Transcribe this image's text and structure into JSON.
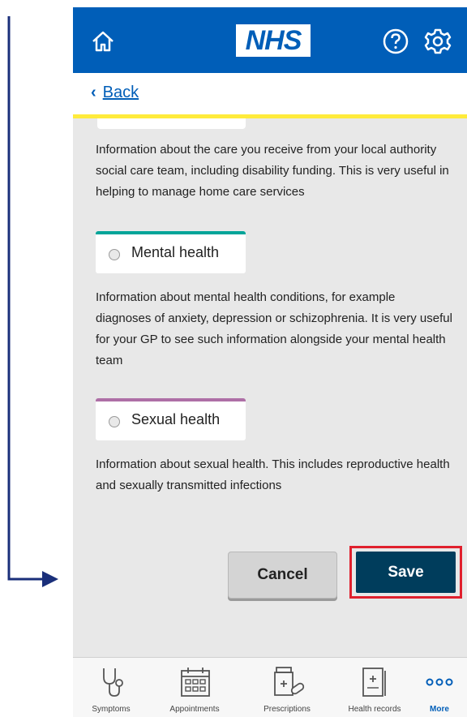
{
  "header": {
    "logo_text": "NHS",
    "home_icon": "home-icon",
    "help_icon": "help-icon",
    "settings_icon": "gear-icon",
    "brand_color": "#005eb8"
  },
  "back": {
    "label": "Back"
  },
  "sections": [
    {
      "description": "Information about the care you receive from your local authority social care team, including disability funding. This is very useful in helping to manage home care services"
    },
    {
      "label": "Mental health",
      "accent": "#00a499",
      "selected": false,
      "description": "Information about mental health conditions, for example diagnoses of anxiety, depression or schizophrenia. It is very useful for your GP to see such information alongside your mental health team"
    },
    {
      "label": "Sexual health",
      "accent": "#ae6fa6",
      "selected": false,
      "description": "Information about sexual health. This includes reproductive health and sexually transmitted infections"
    }
  ],
  "actions": {
    "cancel_label": "Cancel",
    "save_label": "Save",
    "highlight_color": "#e0202d"
  },
  "tabs": [
    {
      "label": "Symptoms",
      "icon": "stethoscope-icon"
    },
    {
      "label": "Appointments",
      "icon": "calendar-icon"
    },
    {
      "label": "Prescriptions",
      "icon": "pills-icon"
    },
    {
      "label": "Health records",
      "icon": "records-icon"
    },
    {
      "label": "More",
      "icon": "more-icon",
      "active": true
    }
  ]
}
